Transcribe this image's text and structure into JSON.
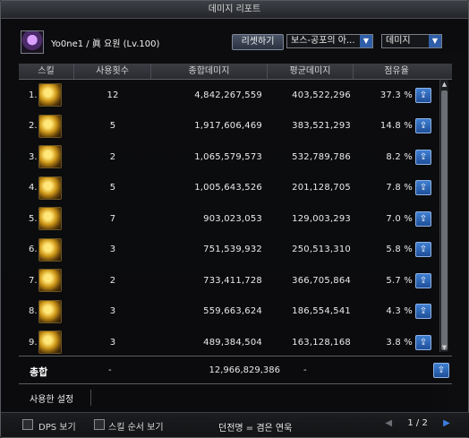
{
  "window": {
    "title": "데미지 리포트"
  },
  "header": {
    "character": "Yo0ne1 / 眞 요원 (Lv.100)",
    "reset_label": "리셋하기",
    "boss_select": "보스-공포의 아...",
    "type_select": "데미지"
  },
  "columns": [
    "스킬",
    "사용횟수",
    "종합데미지",
    "평균데미지",
    "점유율"
  ],
  "rows": [
    {
      "idx": "1.",
      "count": "12",
      "total": "4,842,267,559",
      "avg": "403,522,296",
      "share": "37.3 %"
    },
    {
      "idx": "2.",
      "count": "5",
      "total": "1,917,606,469",
      "avg": "383,521,293",
      "share": "14.8 %"
    },
    {
      "idx": "3.",
      "count": "2",
      "total": "1,065,579,573",
      "avg": "532,789,786",
      "share": "8.2 %"
    },
    {
      "idx": "4.",
      "count": "5",
      "total": "1,005,643,526",
      "avg": "201,128,705",
      "share": "7.8 %"
    },
    {
      "idx": "5.",
      "count": "7",
      "total": "903,023,053",
      "avg": "129,003,293",
      "share": "7.0 %"
    },
    {
      "idx": "6.",
      "count": "3",
      "total": "751,539,932",
      "avg": "250,513,310",
      "share": "5.8 %"
    },
    {
      "idx": "7.",
      "count": "2",
      "total": "733,411,728",
      "avg": "366,705,864",
      "share": "5.7 %"
    },
    {
      "idx": "8.",
      "count": "3",
      "total": "559,663,624",
      "avg": "186,554,541",
      "share": "4.3 %"
    },
    {
      "idx": "9.",
      "count": "3",
      "total": "489,384,504",
      "avg": "163,128,168",
      "share": "3.8 %"
    }
  ],
  "total": {
    "label": "총합",
    "count": "-",
    "total": "12,966,829,386",
    "avg": "-"
  },
  "used_setting": {
    "label": "사용한 설정"
  },
  "footer": {
    "dps_label": "DPS 보기",
    "order_label": "스킬 순서 보기",
    "legend": "던전명 = 겸은 연욱",
    "page": "1 / 2"
  },
  "icons": {
    "share": "share-icon",
    "prev": "chevron-left-icon",
    "next": "chevron-right-icon",
    "dropdown": "chevron-down-icon"
  }
}
